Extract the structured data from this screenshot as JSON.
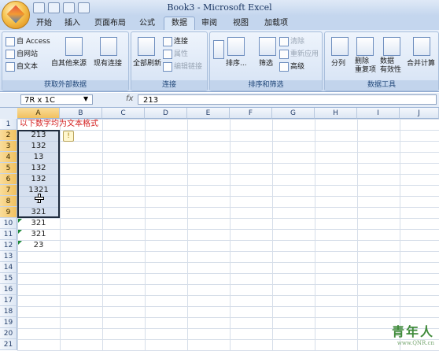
{
  "window": {
    "title": "Book3 - Microsoft Excel"
  },
  "tabs": [
    "开始",
    "插入",
    "页面布局",
    "公式",
    "数据",
    "审阅",
    "视图",
    "加载项"
  ],
  "active_tab": "数据",
  "ribbon": {
    "group_external": {
      "label": "获取外部数据",
      "from_access": "自 Access",
      "from_web": "自网站",
      "from_text": "自文本",
      "from_other": "自其他来源",
      "existing": "现有连接"
    },
    "group_connections": {
      "label": "连接",
      "refresh_all": "全部刷新",
      "connections": "连接",
      "properties": "属性",
      "edit_links": "编辑链接"
    },
    "group_sort": {
      "label": "排序和筛选",
      "sort": "排序...",
      "filter": "筛选",
      "clear": "清除",
      "reapply": "重新应用",
      "advanced": "高级"
    },
    "group_tools": {
      "label": "数据工具",
      "text_to_columns": "分列",
      "remove_duplicates": "删除\n重复项",
      "validation": "数据\n有效性",
      "consolidate": "合并计算"
    }
  },
  "formula_bar": {
    "name_box": "7R x 1C",
    "fx": "fx",
    "value": "213"
  },
  "columns": [
    "A",
    "B",
    "C",
    "D",
    "E",
    "F",
    "G",
    "H",
    "I",
    "J"
  ],
  "rows": [
    "1",
    "2",
    "3",
    "4",
    "5",
    "6",
    "7",
    "8",
    "9",
    "10",
    "11",
    "12",
    "13",
    "14",
    "15",
    "16",
    "17",
    "18",
    "19",
    "20",
    "21"
  ],
  "sheet": {
    "a1": "以下数字均为文本格式",
    "values": [
      "213",
      "132",
      "13",
      "132",
      "132",
      "1321",
      "3",
      "321",
      "321",
      "321",
      "23"
    ]
  },
  "error_indicator": "!",
  "watermark": {
    "brand": "青年人",
    "site": "www.QNR.cn"
  },
  "colors": {
    "selection_header": "#f1c15f",
    "note_text": "#d42121",
    "error_triangle": "#1f8a3a"
  }
}
